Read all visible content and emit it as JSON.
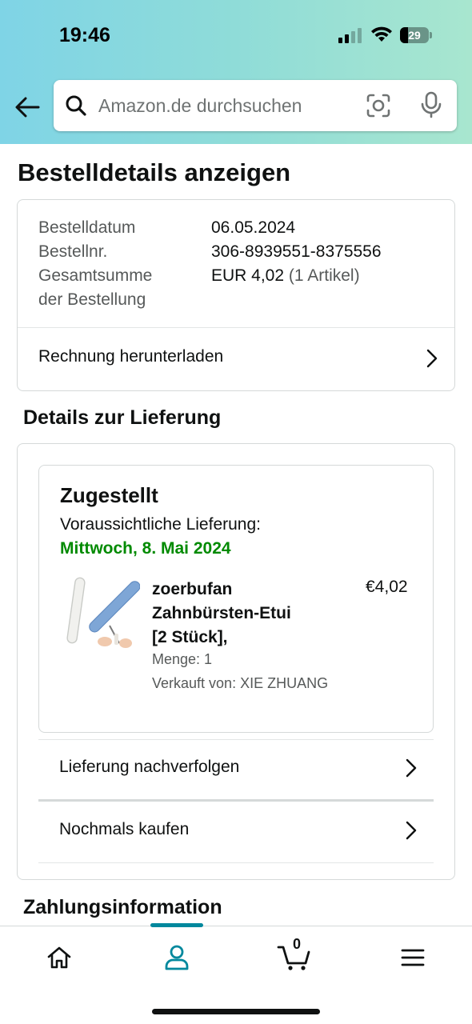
{
  "status_bar": {
    "time": "19:46",
    "battery": "29",
    "battery_level": 0.29
  },
  "header": {
    "back_icon": "arrow-left-icon",
    "search": {
      "placeholder": "Amazon.de durchsuchen",
      "value": ""
    },
    "camera_icon": "camera-scan-icon",
    "mic_icon": "microphone-icon"
  },
  "page": {
    "title": "Bestelldetails anzeigen"
  },
  "order_summary": {
    "date_label": "Bestelldatum",
    "date_value": "06.05.2024",
    "number_label": "Bestellnr.",
    "number_value": "306-8939551-8375556",
    "total_label_line1": "Gesamtsumme",
    "total_label_line2": "der Bestellung",
    "total_value": "EUR 4,02",
    "total_items": "(1 Artikel)",
    "invoice_link": "Rechnung herunterladen"
  },
  "delivery": {
    "heading": "Details zur Lieferung",
    "status": "Zugestellt",
    "eta_label": "Voraussichtliche Lieferung:",
    "eta_date": "Mittwoch, 8. Mai 2024",
    "product": {
      "name_line1": "zoerbufan",
      "name_line2": "Zahnbürsten-Etui",
      "name_line3": "[2 Stück],",
      "price": "€4,02",
      "quantity": "Menge: 1",
      "seller": "Verkauft von: XIE ZHUANG"
    },
    "track_link": "Lieferung nachverfolgen",
    "buy_again_link": "Nochmals kaufen"
  },
  "payment": {
    "heading": "Zahlungsinformation"
  },
  "bottom_nav": {
    "items": [
      "home-icon",
      "account-icon",
      "cart-icon",
      "menu-icon"
    ],
    "active": "account-icon",
    "cart_count": "0"
  },
  "colors": {
    "accent": "#00889d",
    "delivery_green": "#008a00",
    "text": "#0f1111",
    "secondary_text": "#565959"
  }
}
